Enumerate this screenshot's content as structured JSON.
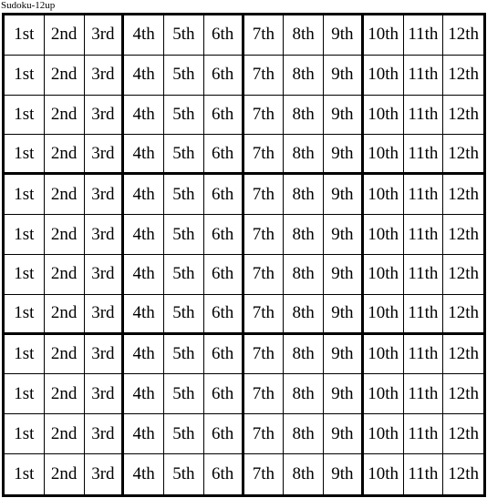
{
  "title": "Sudoku-12up",
  "grid": {
    "rows": 12,
    "cols": 12,
    "box_rows": 4,
    "box_cols": 3,
    "cells": [
      [
        "1st",
        "2nd",
        "3rd",
        "4th",
        "5th",
        "6th",
        "7th",
        "8th",
        "9th",
        "10th",
        "11th",
        "12th"
      ],
      [
        "1st",
        "2nd",
        "3rd",
        "4th",
        "5th",
        "6th",
        "7th",
        "8th",
        "9th",
        "10th",
        "11th",
        "12th"
      ],
      [
        "1st",
        "2nd",
        "3rd",
        "4th",
        "5th",
        "6th",
        "7th",
        "8th",
        "9th",
        "10th",
        "11th",
        "12th"
      ],
      [
        "1st",
        "2nd",
        "3rd",
        "4th",
        "5th",
        "6th",
        "7th",
        "8th",
        "9th",
        "10th",
        "11th",
        "12th"
      ],
      [
        "1st",
        "2nd",
        "3rd",
        "4th",
        "5th",
        "6th",
        "7th",
        "8th",
        "9th",
        "10th",
        "11th",
        "12th"
      ],
      [
        "1st",
        "2nd",
        "3rd",
        "4th",
        "5th",
        "6th",
        "7th",
        "8th",
        "9th",
        "10th",
        "11th",
        "12th"
      ],
      [
        "1st",
        "2nd",
        "3rd",
        "4th",
        "5th",
        "6th",
        "7th",
        "8th",
        "9th",
        "10th",
        "11th",
        "12th"
      ],
      [
        "1st",
        "2nd",
        "3rd",
        "4th",
        "5th",
        "6th",
        "7th",
        "8th",
        "9th",
        "10th",
        "11th",
        "12th"
      ],
      [
        "1st",
        "2nd",
        "3rd",
        "4th",
        "5th",
        "6th",
        "7th",
        "8th",
        "9th",
        "10th",
        "11th",
        "12th"
      ],
      [
        "1st",
        "2nd",
        "3rd",
        "4th",
        "5th",
        "6th",
        "7th",
        "8th",
        "9th",
        "10th",
        "11th",
        "12th"
      ],
      [
        "1st",
        "2nd",
        "3rd",
        "4th",
        "5th",
        "6th",
        "7th",
        "8th",
        "9th",
        "10th",
        "11th",
        "12th"
      ],
      [
        "1st",
        "2nd",
        "3rd",
        "4th",
        "5th",
        "6th",
        "7th",
        "8th",
        "9th",
        "10th",
        "11th",
        "12th"
      ]
    ]
  }
}
